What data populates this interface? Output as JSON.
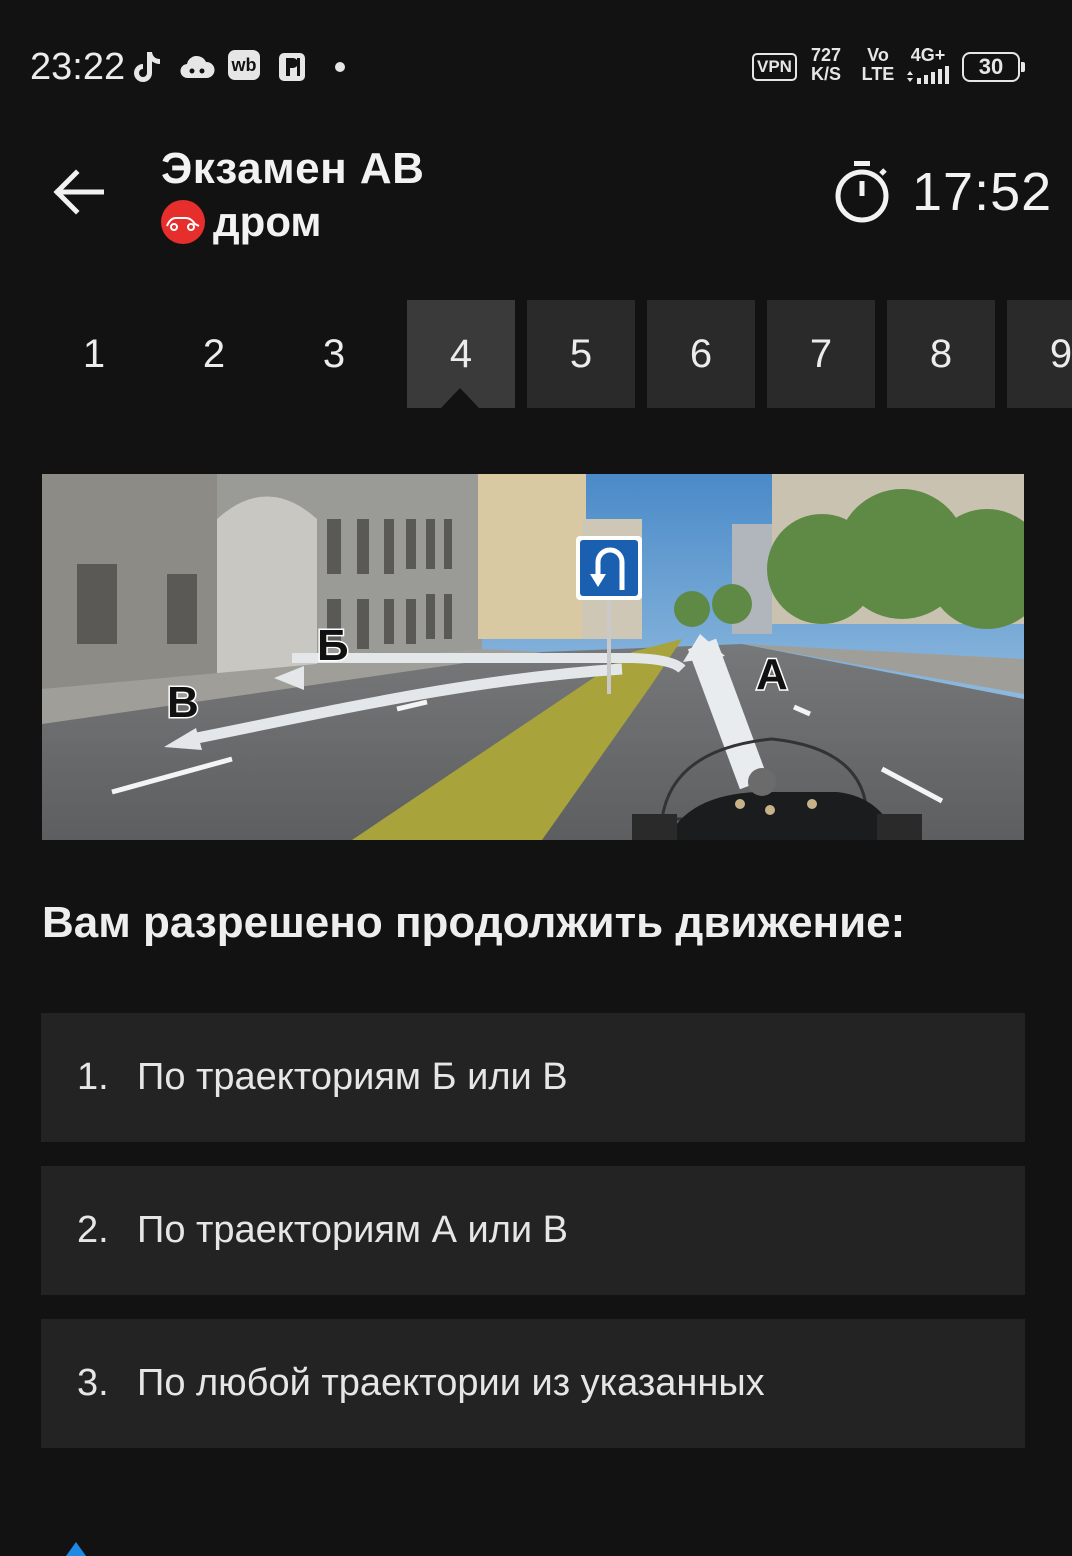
{
  "status_bar": {
    "time": "23:22",
    "app_icons": [
      "tiktok-icon",
      "cloud-icon",
      "wb-icon",
      "parking-icon"
    ],
    "wb_label": "wb",
    "vpn_label": "VPN",
    "speed_value": "727",
    "speed_unit": "K/S",
    "volte_top": "Vo",
    "volte_bottom": "LTE",
    "network": "4G+",
    "battery": "30"
  },
  "header": {
    "title": "Экзамен АВ",
    "brand": "дром",
    "timer": "17:52"
  },
  "tabs": {
    "items": [
      "1",
      "2",
      "3",
      "4",
      "5",
      "6",
      "7",
      "8",
      "9"
    ],
    "active_index": 3
  },
  "picture": {
    "labels": {
      "a": "А",
      "b": "Б",
      "v": "В"
    },
    "road_sign": "u-turn-sign"
  },
  "question": "Вам разрешено продолжить движение:",
  "answers": [
    {
      "num": "1.",
      "text": "По траекториям Б или В"
    },
    {
      "num": "2.",
      "text": "По траекториям А или В"
    },
    {
      "num": "3.",
      "text": "По любой траектории из указанных"
    }
  ],
  "colors": {
    "background": "#121212",
    "answer_background": "#232323",
    "tab_visited": "#2a2a2a",
    "tab_active": "#3a3a3a",
    "brand_red": "#e62e2d"
  }
}
